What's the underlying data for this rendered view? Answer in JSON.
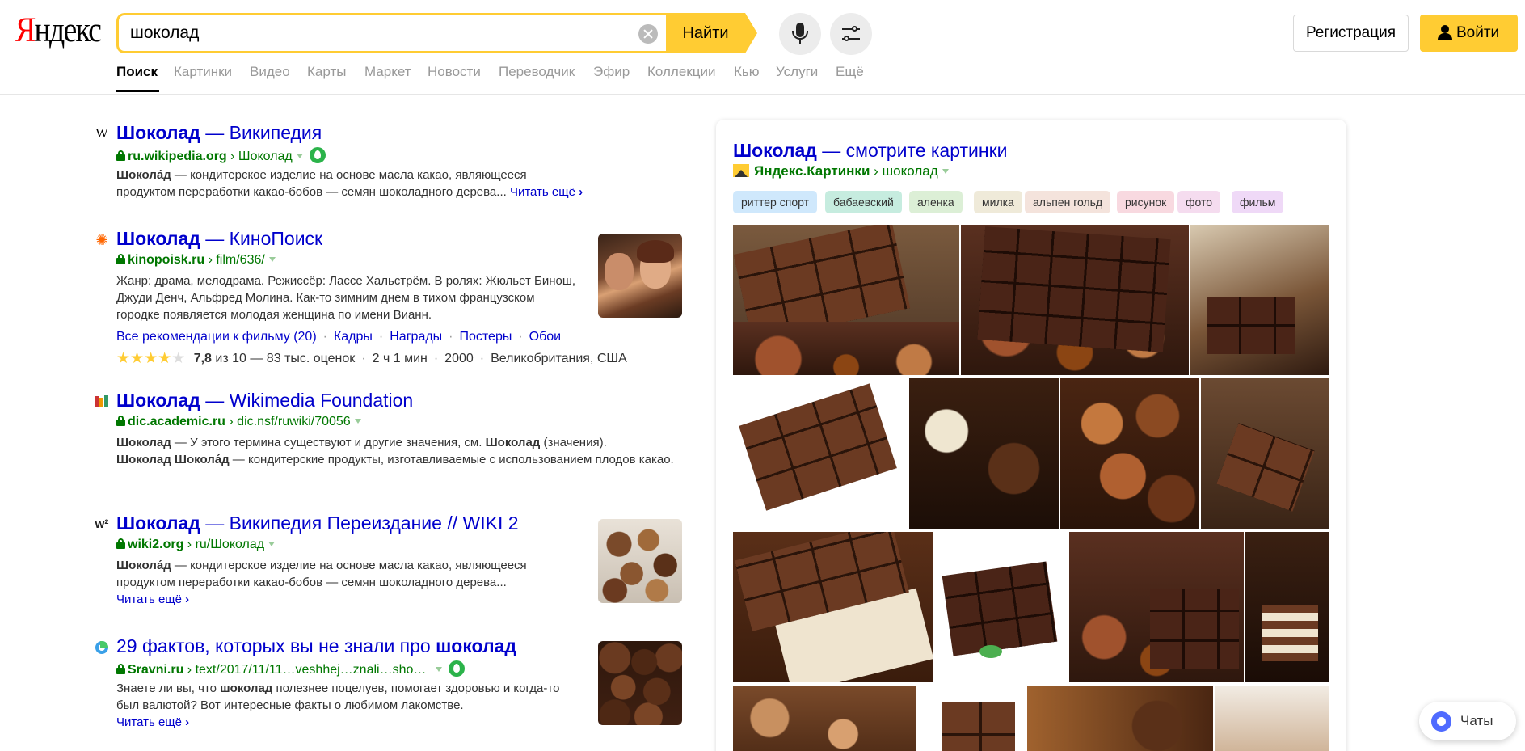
{
  "header": {
    "logo": "Яндекс",
    "search_value": "шоколад",
    "search_button": "Найти",
    "register": "Регистрация",
    "login": "Войти"
  },
  "nav": {
    "items": [
      "Поиск",
      "Картинки",
      "Видео",
      "Карты",
      "Маркет",
      "Новости",
      "Переводчик",
      "Эфир",
      "Коллекции",
      "Кью",
      "Услуги",
      "Ещё"
    ]
  },
  "results": [
    {
      "title_bold": "Шоколад",
      "title_rest": " — Википедия",
      "domain": "ru.wikipedia.org",
      "path": "Шоколад",
      "snippet_bold": "Шокола́д",
      "snippet": " — кондитерское изделие на основе масла какао, являющееся продуктом переработки какао-бобов — семян шоколадного дерева...",
      "more": "Читать ещё"
    },
    {
      "title_bold": "Шоколад",
      "title_rest": " — КиноПоиск",
      "domain": "kinopoisk.ru",
      "path": "film/636/",
      "snippet": "Жанр: драма, мелодрама. Режиссёр: Лассе Хальстрём. В ролях: Жюльет Бинош, Джуди Денч, Альфред Молина. Как-то зимним днем в тихом французском городке появляется молодая женщина по имени Вианн.",
      "sitelinks": [
        "Все рекомендации к фильму (20)",
        "Кадры",
        "Награды",
        "Постеры",
        "Обои"
      ],
      "rating_value": "7,8",
      "rating_suffix": " из 10 — 83 тыс. оценок",
      "duration": "2 ч 1 мин",
      "year": "2000",
      "country": "Великобритания, США",
      "stars": 4
    },
    {
      "title_bold": "Шоколад",
      "title_rest": " — Wikimedia Foundation",
      "domain": "dic.academic.ru",
      "path": "dic.nsf/ruwiki/70056",
      "line1_bold": "Шоколад",
      "line1_rest": " — У этого термина существуют и другие значения, см. ",
      "line1_bold2": "Шоколад",
      "line1_end": " (значения).",
      "line2_bold": "Шоколад Шокола́д",
      "line2_rest": " — кондитерские продукты, изготавливаемые с использованием плодов какао."
    },
    {
      "title_bold": "Шоколад",
      "title_rest": " — Википедия Переиздание // WIKI 2",
      "domain": "wiki2.org",
      "path": "ru/Шоколад",
      "snippet_bold": "Шокола́д",
      "snippet": " — кондитерское изделие на основе масла какао, являющееся продуктом переработки какао-бобов — семян шоколадного дерева...",
      "more": "Читать ещё"
    },
    {
      "title_plain": "29 фактов, которых вы не знали про ",
      "title_bold": "шоколад",
      "domain": "Sravni.ru",
      "path": "text/2017/11/11…veshhej…znali…sho…",
      "s1": "Знаете ли вы, что ",
      "s1_bold": "шоколад",
      "s1_rest": " полезнее поцелуев, помогает здоровью и когда-то был валютой? Вот интересные факты о любимом лакомстве.",
      "more": "Читать ещё"
    }
  ],
  "images_panel": {
    "title_bold": "Шоколад",
    "title_rest": " — смотрите картинки",
    "source": "Яндекс.Картинки",
    "source_path": "шоколад",
    "tags": [
      "риттер спорт",
      "бабаевский",
      "аленка",
      "милка",
      "альпен гольд",
      "рисунок",
      "фото",
      "фильм"
    ],
    "tag_colors": [
      "#cfe8fc",
      "#c6ecdf",
      "#dcefd6",
      "#efead9",
      "#f4e3dc",
      "#f8d9e0",
      "#f5dcef",
      "#efd9f7"
    ]
  },
  "chat": {
    "label": "Чаты"
  },
  "colors": {
    "accent": "#ffcc33",
    "link": "#0000cc",
    "url": "#007700"
  }
}
